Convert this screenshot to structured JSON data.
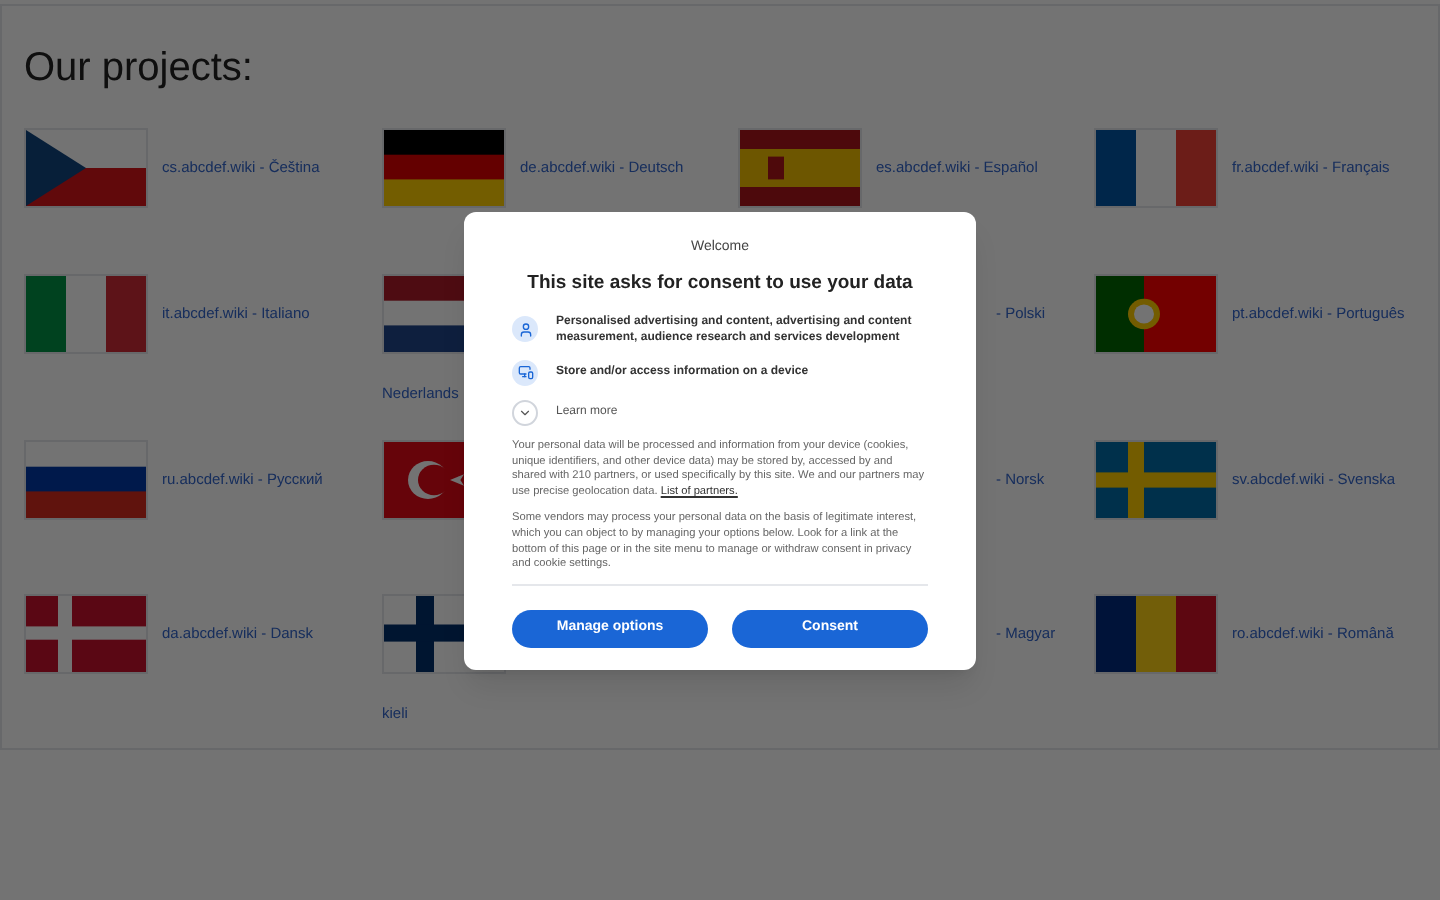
{
  "page": {
    "heading": "Our projects:"
  },
  "projects": [
    {
      "kind": "cz",
      "label": "cs.abcdef.wiki - Čeština"
    },
    {
      "kind": "de",
      "label": "de.abcdef.wiki - Deutsch"
    },
    {
      "kind": "es",
      "label": "es.abcdef.wiki - Español"
    },
    {
      "kind": "fr",
      "label": "fr.abcdef.wiki - Français"
    },
    {
      "kind": "it",
      "label": "it.abcdef.wiki - Italiano"
    },
    {
      "kind": "nl",
      "caption": "Nederlands"
    },
    {
      "kind": "none",
      "label": "- Polski"
    },
    {
      "kind": "pt",
      "label": "pt.abcdef.wiki - Português"
    },
    {
      "kind": "ru",
      "label": "ru.abcdef.wiki - Русский"
    },
    {
      "kind": "tr"
    },
    {
      "kind": "none",
      "label": "- Norsk"
    },
    {
      "kind": "se",
      "label": "sv.abcdef.wiki - Svenska"
    },
    {
      "kind": "dk",
      "label": "da.abcdef.wiki - Dansk"
    },
    {
      "kind": "fi",
      "caption": "kieli"
    },
    {
      "kind": "none",
      "label": "- Magyar"
    },
    {
      "kind": "ro",
      "label": "ro.abcdef.wiki - Română"
    }
  ],
  "dialog": {
    "welcome": "Welcome",
    "title": "This site asks for consent to use your data",
    "purposes": [
      {
        "kind": "person",
        "text": "Personalised advertising and content, advertising and content measurement, audience research and services development"
      },
      {
        "kind": "device",
        "text": "Store and/or access information on a device"
      },
      {
        "kind": "expand",
        "text": "Learn more"
      }
    ],
    "paragraph_1": "Your personal data will be processed and information from your device (cookies, unique identifiers, and other device data) may be stored by, accessed by and shared with 210 partners, or used specifically by this site. We and our partners may use precise geolocation data.",
    "partners_link": "List of partners.",
    "paragraph_2": "Some vendors may process your personal data on the basis of legitimate interest, which you can object to by managing your options below. Look for a link at the bottom of this page or in the site menu to manage or withdraw consent in privacy and cookie settings.",
    "buttons": [
      "Manage options",
      "Consent"
    ]
  }
}
